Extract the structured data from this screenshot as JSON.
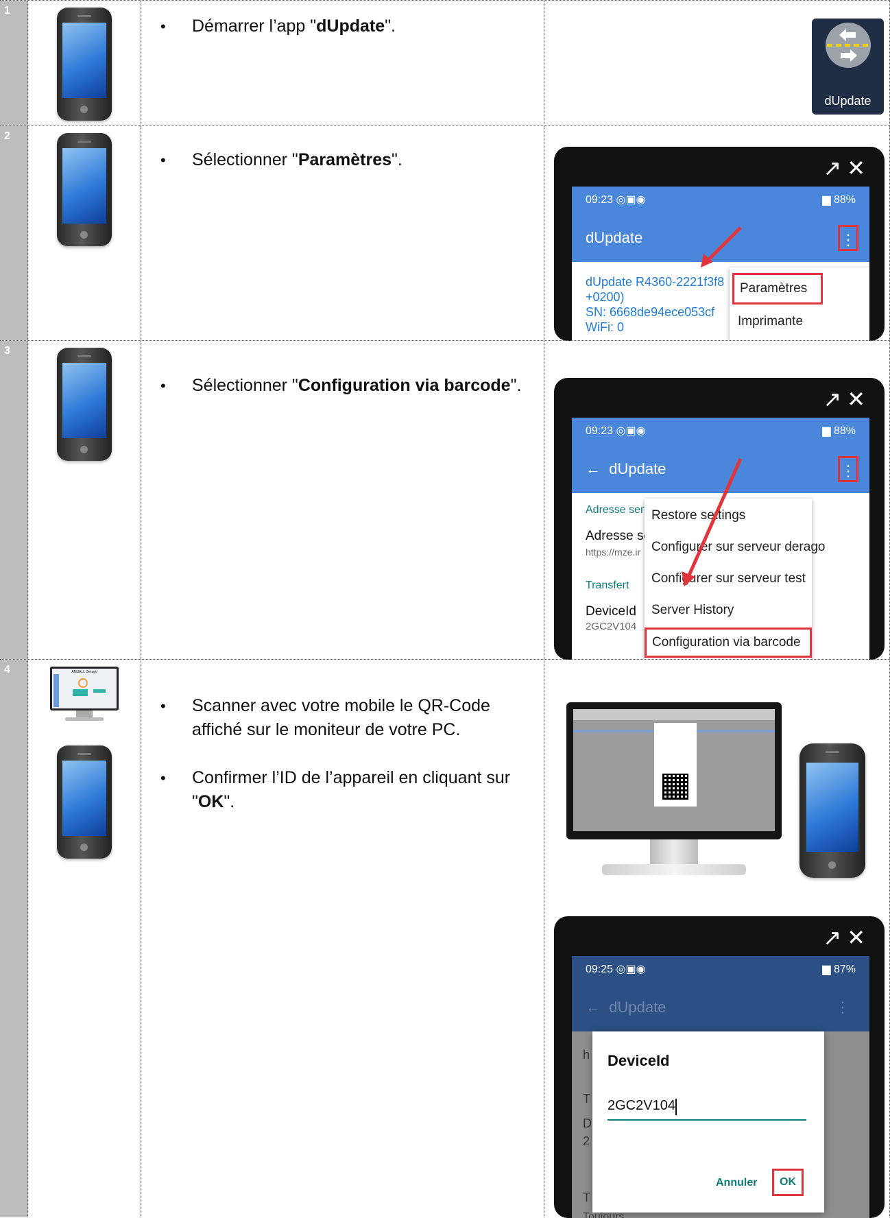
{
  "rows": [
    {
      "num": "1"
    },
    {
      "num": "2"
    },
    {
      "num": "3"
    },
    {
      "num": "4"
    }
  ],
  "step1": {
    "pre": "Démarrer l’app \"",
    "bold": "dUpdate",
    "post": "\"."
  },
  "step2": {
    "pre": "Sélectionner \"",
    "bold": "Paramètres",
    "post": "\"."
  },
  "step3": {
    "pre": "Sélectionner \"",
    "bold": "Configuration via barcode",
    "post": "\"."
  },
  "step4": {
    "b1": "Scanner avec votre mobile le QR-Code affiché sur le moniteur de votre PC.",
    "b2_pre": "Confirmer l’ID de l’appareil en cliquant sur \"",
    "b2_bold": "OK",
    "b2_post": "\"."
  },
  "app_icon": {
    "label": "dUpdate",
    "bg": "#1f2e45"
  },
  "shot2": {
    "time": "09:23",
    "battery": "88%",
    "title": "dUpdate",
    "info": [
      "dUpdate R4360-2221f3f8",
      "+0200)",
      "SN: 6668de94ece053cf",
      "WiFi: 0"
    ],
    "menu": [
      "Paramètres",
      "Imprimante"
    ]
  },
  "shot3": {
    "time": "09:23",
    "battery": "88%",
    "title": "dUpdate",
    "left": {
      "sec1": "Adresse serv",
      "item1": "Adresse ser",
      "item1_sub": "https://mze.ir",
      "sec2": "Transfert",
      "item2": "DeviceId",
      "item2_sub": "2GC2V104"
    },
    "menu": [
      "Restore settings",
      "Configurer sur serveur derago",
      "Configurer sur serveur test",
      "Server History",
      "Configuration via barcode"
    ]
  },
  "monitor_title": "AMSALL Derago",
  "shot4": {
    "time": "09:25",
    "battery": "87%",
    "title": "dUpdate",
    "dialog_title": "DeviceId",
    "input_value": "2GC2V104",
    "cancel": "Annuler",
    "ok": "OK",
    "bottom": "Toujours",
    "edge_letters": [
      "h",
      "T",
      "D",
      "2",
      "T"
    ]
  },
  "colors": {
    "appbar": "#4a86d9",
    "highlight": "#e0353d",
    "teal": "#0f7d7a",
    "link": "#1f7dd6"
  }
}
